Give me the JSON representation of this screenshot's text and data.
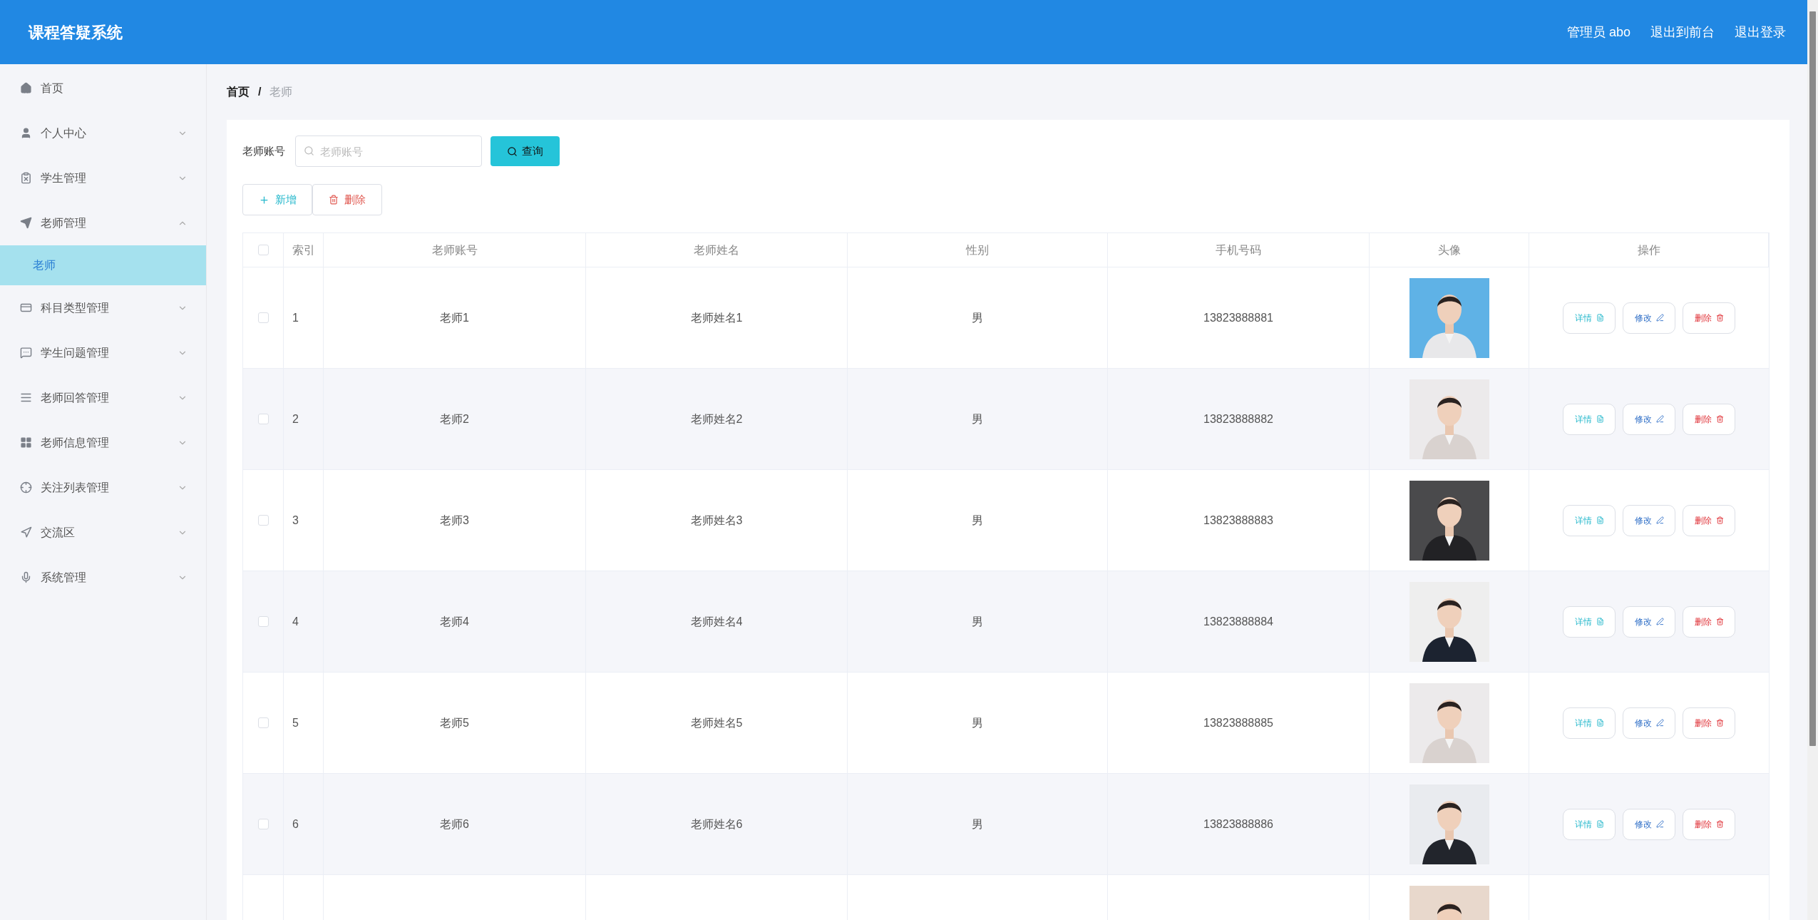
{
  "header": {
    "title": "课程答疑系统",
    "links": [
      "管理员 abo",
      "退出到前台",
      "退出登录"
    ]
  },
  "sidebar": {
    "items": [
      {
        "label": "首页"
      },
      {
        "label": "个人中心",
        "expanded": false
      },
      {
        "label": "学生管理",
        "expanded": false
      },
      {
        "label": "老师管理",
        "expanded": true,
        "children": [
          {
            "label": "老师",
            "selected": true
          }
        ]
      },
      {
        "label": "科目类型管理",
        "expanded": false
      },
      {
        "label": "学生问题管理",
        "expanded": false
      },
      {
        "label": "老师回答管理",
        "expanded": false
      },
      {
        "label": "老师信息管理",
        "expanded": false
      },
      {
        "label": "关注列表管理",
        "expanded": false
      },
      {
        "label": "交流区",
        "expanded": false
      },
      {
        "label": "系统管理",
        "expanded": false
      }
    ]
  },
  "breadcrumb": {
    "items": [
      "首页",
      "老师"
    ],
    "separator": "/"
  },
  "search": {
    "label": "老师账号",
    "placeholder": "老师账号",
    "button": "查询"
  },
  "actions": [
    "新增",
    "删除"
  ],
  "table": {
    "select_all_checked": false,
    "columns": [
      "索引",
      "老师账号",
      "老师姓名",
      "性别",
      "手机号码",
      "头像",
      "操作"
    ],
    "rows": [
      {
        "kind": "full",
        "checked": false,
        "index": "1",
        "account": "老师1",
        "name": "老师姓名1",
        "gender": "男",
        "phone": "13823888881",
        "buttons": [
          "详情",
          "修改",
          "删除"
        ]
      },
      {
        "kind": "full",
        "checked": false,
        "index": "2",
        "account": "老师2",
        "name": "老师姓名2",
        "gender": "男",
        "phone": "13823888882",
        "buttons": [
          "详情",
          "修改",
          "删除"
        ]
      },
      {
        "kind": "full",
        "checked": false,
        "index": "3",
        "account": "老师3",
        "name": "老师姓名3",
        "gender": "男",
        "phone": "13823888883",
        "buttons": [
          "详情",
          "修改",
          "删除"
        ]
      },
      {
        "kind": "full",
        "checked": false,
        "index": "4",
        "account": "老师4",
        "name": "老师姓名4",
        "gender": "男",
        "phone": "13823888884",
        "buttons": [
          "详情",
          "修改",
          "删除"
        ]
      },
      {
        "kind": "full",
        "checked": false,
        "index": "5",
        "account": "老师5",
        "name": "老师姓名5",
        "gender": "男",
        "phone": "13823888885",
        "buttons": [
          "详情",
          "修改",
          "删除"
        ]
      },
      {
        "kind": "full",
        "checked": false,
        "index": "6",
        "account": "老师6",
        "name": "老师姓名6",
        "gender": "男",
        "phone": "13823888886",
        "buttons": [
          "详情",
          "修改",
          "删除"
        ]
      },
      {
        "kind": "cut"
      }
    ]
  }
}
